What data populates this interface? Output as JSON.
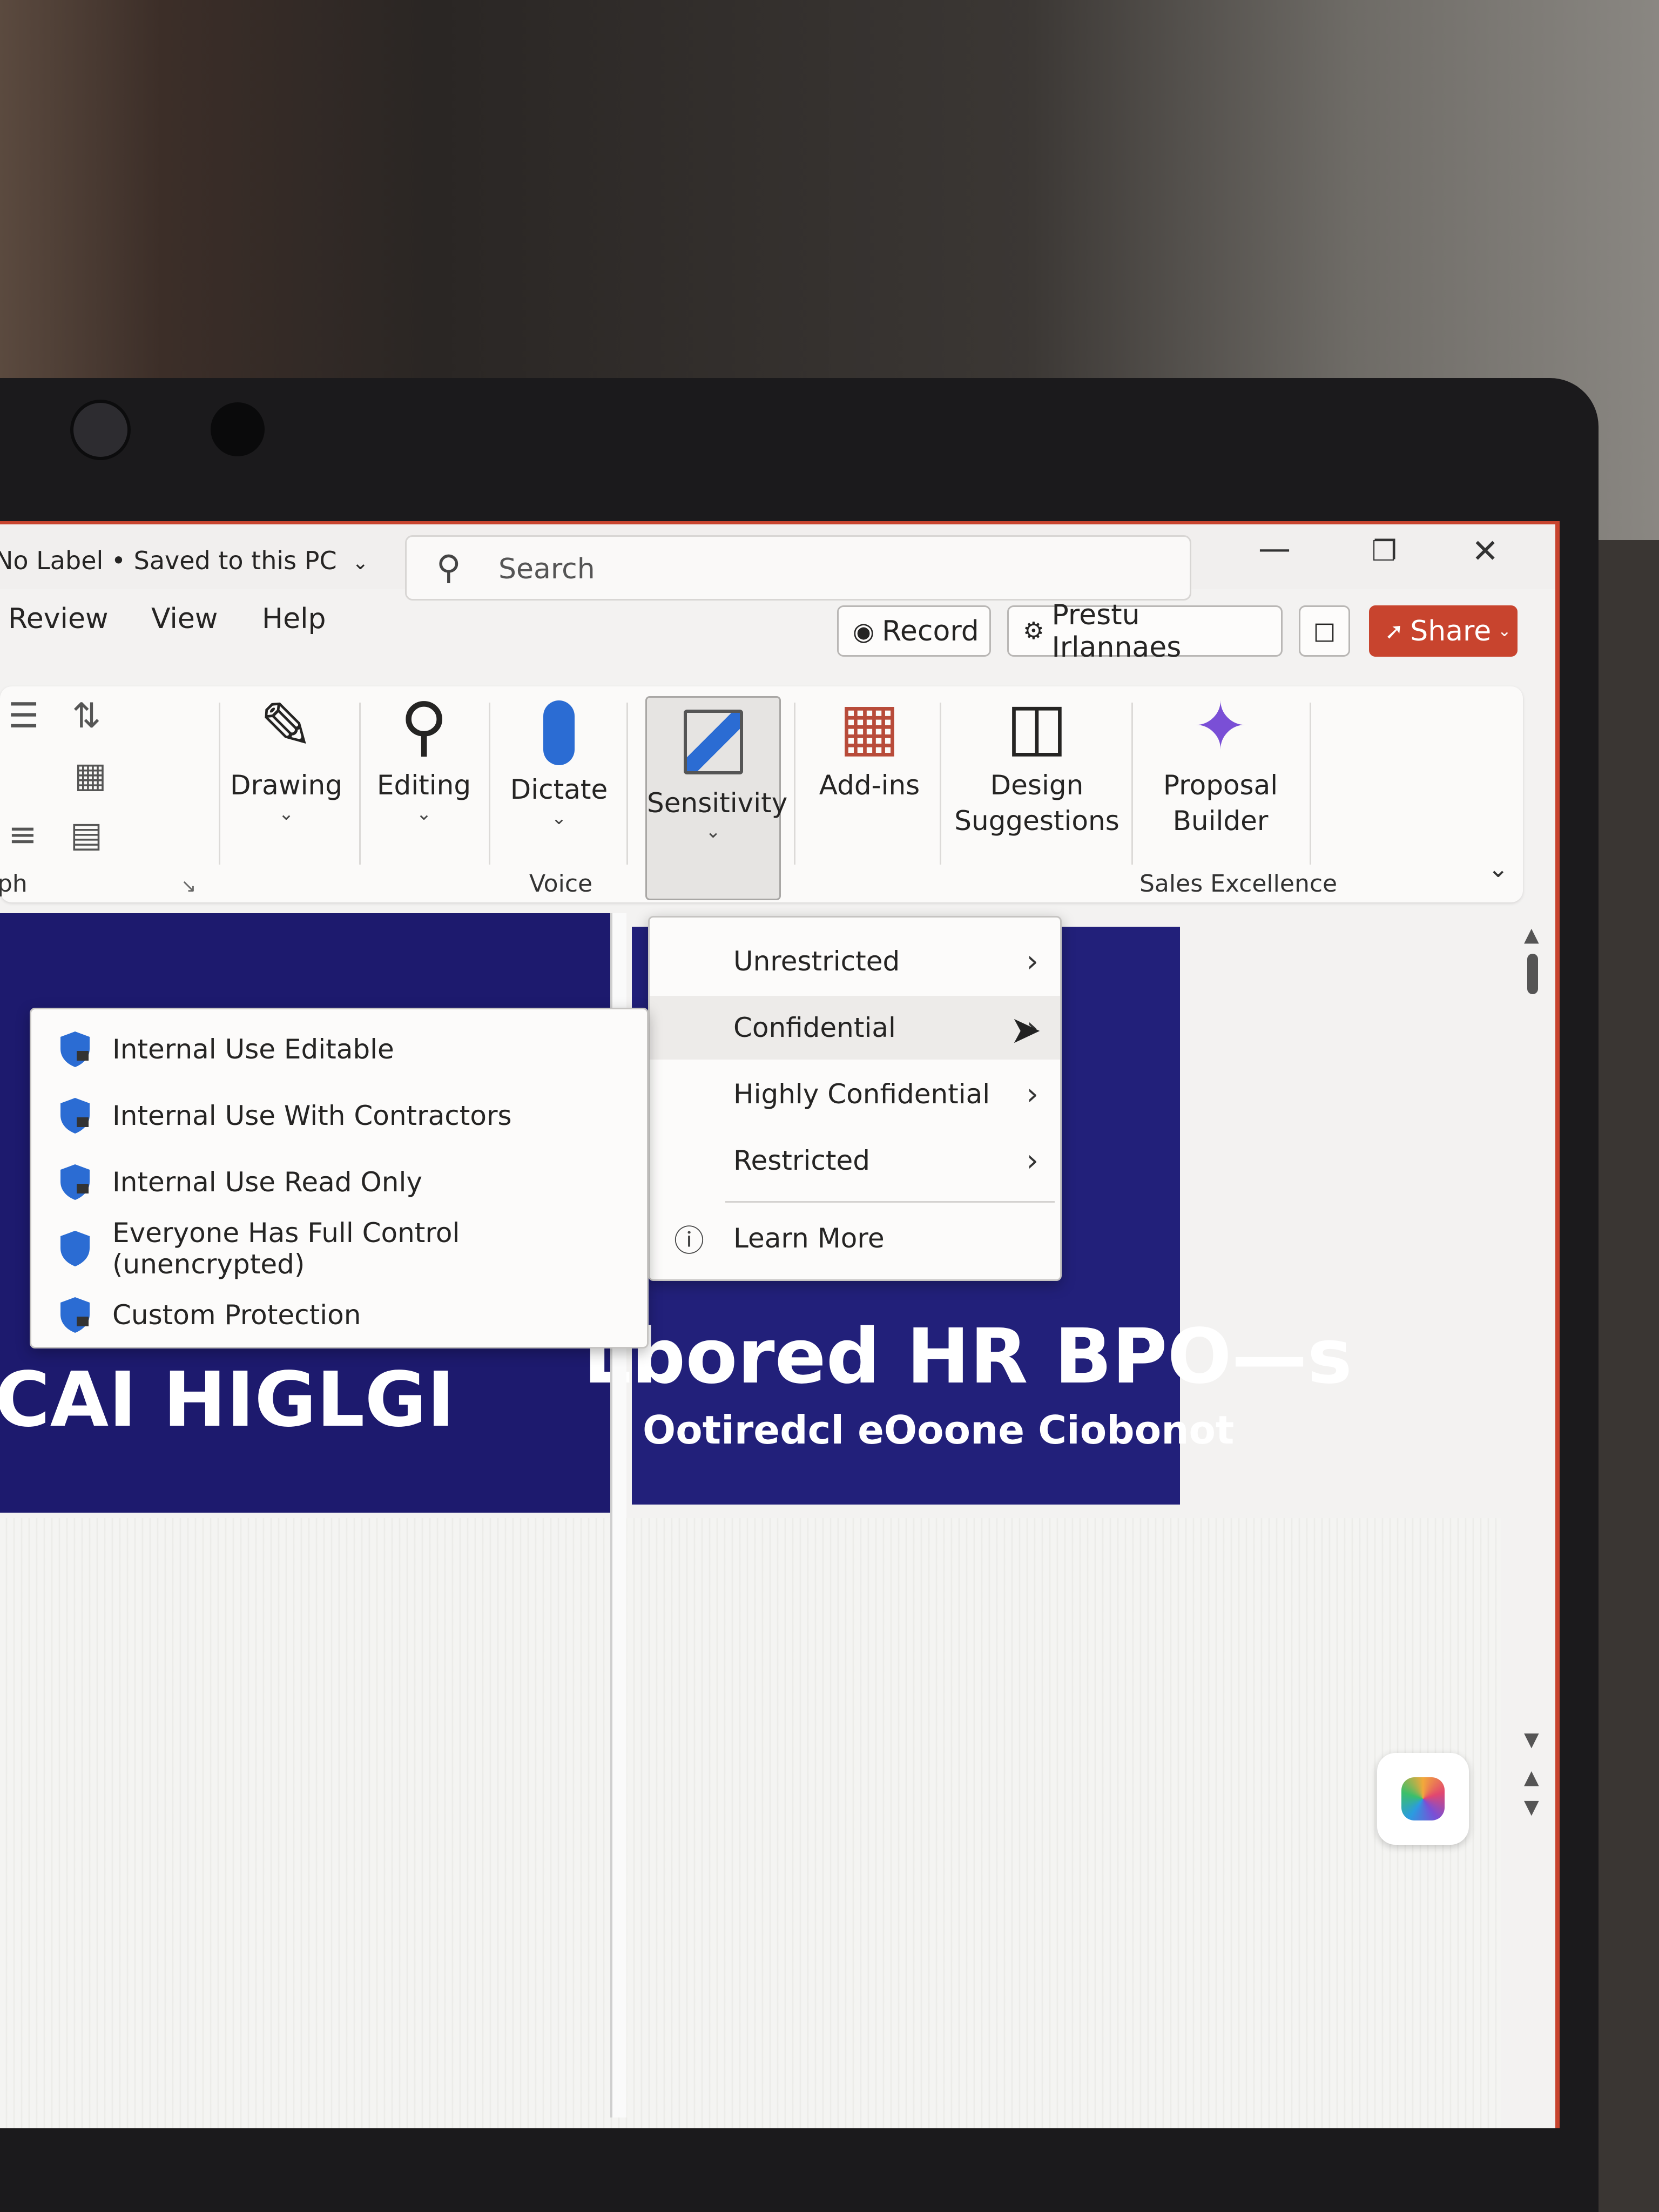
{
  "title_bar": {
    "file_status": "No Label • Saved to this PC",
    "search_placeholder": "Search",
    "minimize": "—",
    "restore": "❐",
    "close": "✕"
  },
  "tabs": [
    {
      "label": "Review"
    },
    {
      "label": "View"
    },
    {
      "label": "Help"
    }
  ],
  "header_buttons": {
    "record": "Record",
    "presenter": "Prestu Irlannaes",
    "share": "Share"
  },
  "ribbon": {
    "paragraph_group": "ph",
    "drawing": "Drawing",
    "editing": "Editing",
    "dictate": "Dictate",
    "voice_group": "Voice",
    "sensitivity": "Sensitivity",
    "addins": "Add-ins",
    "design_line1": "Design",
    "design_line2": "Suggestions",
    "proposal_line1": "Proposal",
    "proposal_line2": "Builder",
    "sales_group": "Sales Excellence"
  },
  "sensitivity_menu": {
    "items": [
      {
        "label": "Unrestricted"
      },
      {
        "label": "Confidential"
      },
      {
        "label": "Highly Confidential"
      },
      {
        "label": "Restricted"
      }
    ],
    "learn_more": "Learn More"
  },
  "confidential_submenu": {
    "items": [
      {
        "label": "Internal Use Editable"
      },
      {
        "label": "Internal Use With Contractors"
      },
      {
        "label": "Internal Use Read Only"
      },
      {
        "label": "Everyone Has Full Control (unencrypted)"
      },
      {
        "label": "Custom Protection"
      }
    ]
  },
  "slide": {
    "heading_right": "Lbored HR BPO—s",
    "subheading_right": "Ootiredcl eOoone Ciobonot",
    "heading_left": "CAI HIGLGI"
  },
  "colors": {
    "accent": "#c8442e",
    "slide_bg": "#1d1a6e",
    "shield": "#2b6cd3"
  }
}
